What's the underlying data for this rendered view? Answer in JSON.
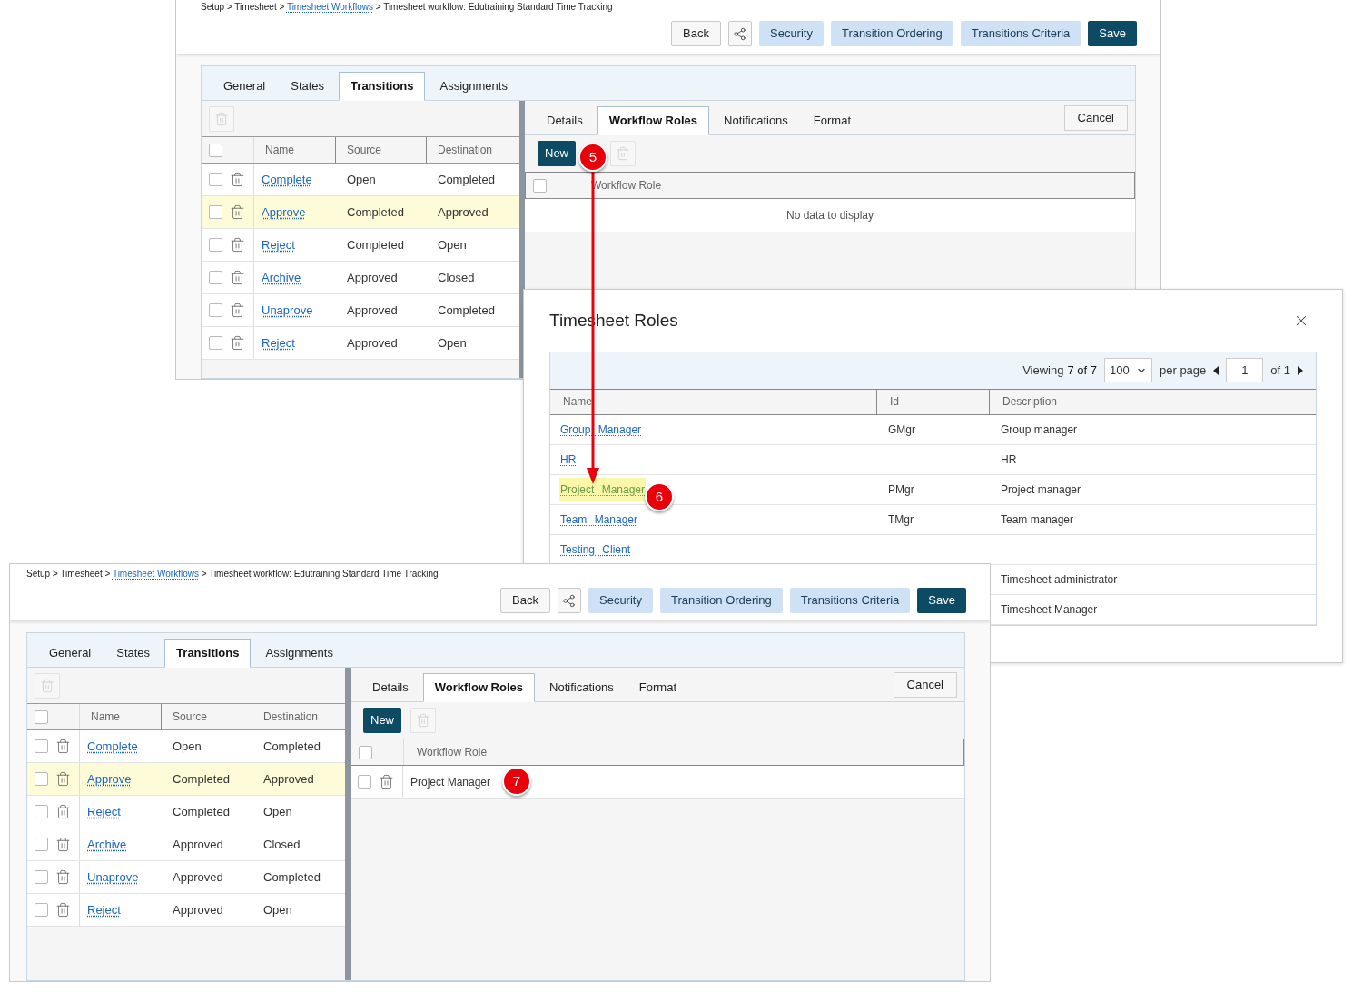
{
  "top_panel": {
    "breadcrumb": {
      "separator": ">",
      "items": [
        {
          "label": "Setup",
          "link": false
        },
        {
          "label": "Timesheet",
          "link": false
        },
        {
          "label": "Timesheet Workflows",
          "link": true
        },
        {
          "label": "Timesheet workflow: Edutraining Standard Time Tracking",
          "link": false
        }
      ]
    },
    "buttons": [
      {
        "kind": "default",
        "label": "Back"
      },
      {
        "kind": "share"
      },
      {
        "kind": "light",
        "label": "Security"
      },
      {
        "kind": "light",
        "label": "Transition Ordering"
      },
      {
        "kind": "light",
        "label": "Transitions Criteria"
      },
      {
        "kind": "primary",
        "label": "Save"
      }
    ],
    "tabs": [
      {
        "label": "General",
        "selected": false
      },
      {
        "label": "States",
        "selected": false
      },
      {
        "label": "Transitions",
        "selected": true
      },
      {
        "label": "Assignments",
        "selected": false
      }
    ],
    "transitions": {
      "all_checked": false,
      "columns": [
        "Name",
        "Source",
        "Destination"
      ],
      "rows": [
        {
          "name": "Complete",
          "source": "Open",
          "destination": "Completed",
          "selected": false,
          "checked": false
        },
        {
          "name": "Approve",
          "source": "Completed",
          "destination": "Approved",
          "selected": true,
          "checked": false
        },
        {
          "name": "Reject",
          "source": "Completed",
          "destination": "Open",
          "selected": false,
          "checked": false
        },
        {
          "name": "Archive",
          "source": "Approved",
          "destination": "Closed",
          "selected": false,
          "checked": false
        },
        {
          "name": "Unaprove",
          "source": "Approved",
          "destination": "Completed",
          "selected": false,
          "checked": false
        },
        {
          "name": "Reject",
          "source": "Approved",
          "destination": "Open",
          "selected": false,
          "checked": false
        }
      ]
    },
    "subtabs": [
      {
        "label": "Details",
        "selected": false
      },
      {
        "label": "Workflow Roles",
        "selected": true
      },
      {
        "label": "Notifications",
        "selected": false
      },
      {
        "label": "Format",
        "selected": false
      }
    ],
    "cancel": "Cancel",
    "new_button": "New",
    "roles_grid": {
      "all_checked": false,
      "column": "Workflow Role",
      "empty_message": "No data to display"
    }
  },
  "dialog": {
    "title": "Timesheet Roles",
    "viewing": "Viewing",
    "count": "7 of 7",
    "per_page_value": "100",
    "per_page_label": "per page",
    "page": "1",
    "page_total": "of 1",
    "columns": [
      "Name",
      "Id",
      "Description"
    ],
    "rows": [
      {
        "name": "Group Manager",
        "id": "GMgr",
        "description": "Group manager",
        "selected": false
      },
      {
        "name": "HR",
        "description": "HR",
        "selected": false
      },
      {
        "name": "Project Manager",
        "id": "PMgr",
        "description": "Project manager",
        "selected": true
      },
      {
        "name": "Team Manager",
        "id": "TMgr",
        "description": "Team manager",
        "selected": false
      },
      {
        "name": "Testing Client",
        "selected": false
      },
      {
        "description": "Timesheet administrator"
      },
      {
        "description": "Timesheet Manager"
      }
    ]
  },
  "bottom_panel": {
    "breadcrumb": {
      "separator": ">",
      "items": [
        {
          "label": "Setup",
          "link": false
        },
        {
          "label": "Timesheet",
          "link": false
        },
        {
          "label": "Timesheet Workflows",
          "link": true
        },
        {
          "label": "Timesheet workflow: Edutraining Standard Time Tracking",
          "link": false
        }
      ]
    },
    "buttons": [
      {
        "kind": "default",
        "label": "Back"
      },
      {
        "kind": "share"
      },
      {
        "kind": "light",
        "label": "Security"
      },
      {
        "kind": "light",
        "label": "Transition Ordering"
      },
      {
        "kind": "light",
        "label": "Transitions Criteria"
      },
      {
        "kind": "primary",
        "label": "Save"
      }
    ],
    "tabs": [
      {
        "label": "General",
        "selected": false
      },
      {
        "label": "States",
        "selected": false
      },
      {
        "label": "Transitions",
        "selected": true
      },
      {
        "label": "Assignments",
        "selected": false
      }
    ],
    "transitions": {
      "all_checked": false,
      "columns": [
        "Name",
        "Source",
        "Destination"
      ],
      "rows": [
        {
          "name": "Complete",
          "source": "Open",
          "destination": "Completed",
          "selected": false,
          "checked": false
        },
        {
          "name": "Approve",
          "source": "Completed",
          "destination": "Approved",
          "selected": true,
          "checked": false
        },
        {
          "name": "Reject",
          "source": "Completed",
          "destination": "Open",
          "selected": false,
          "checked": false
        },
        {
          "name": "Archive",
          "source": "Approved",
          "destination": "Closed",
          "selected": false,
          "checked": false
        },
        {
          "name": "Unaprove",
          "source": "Approved",
          "destination": "Completed",
          "selected": false,
          "checked": false
        },
        {
          "name": "Reject",
          "source": "Approved",
          "destination": "Open",
          "selected": false,
          "checked": false
        }
      ]
    },
    "subtabs": [
      {
        "label": "Details",
        "selected": false
      },
      {
        "label": "Workflow Roles",
        "selected": true
      },
      {
        "label": "Notifications",
        "selected": false
      },
      {
        "label": "Format",
        "selected": false
      }
    ],
    "cancel": "Cancel",
    "new_button": "New",
    "roles_grid": {
      "all_checked": false,
      "column": "Workflow Role",
      "rows": [
        {
          "role": "Project Manager",
          "checked": false
        }
      ]
    }
  },
  "callouts": [
    {
      "label": "5"
    },
    {
      "label": "6"
    },
    {
      "label": "7"
    }
  ]
}
